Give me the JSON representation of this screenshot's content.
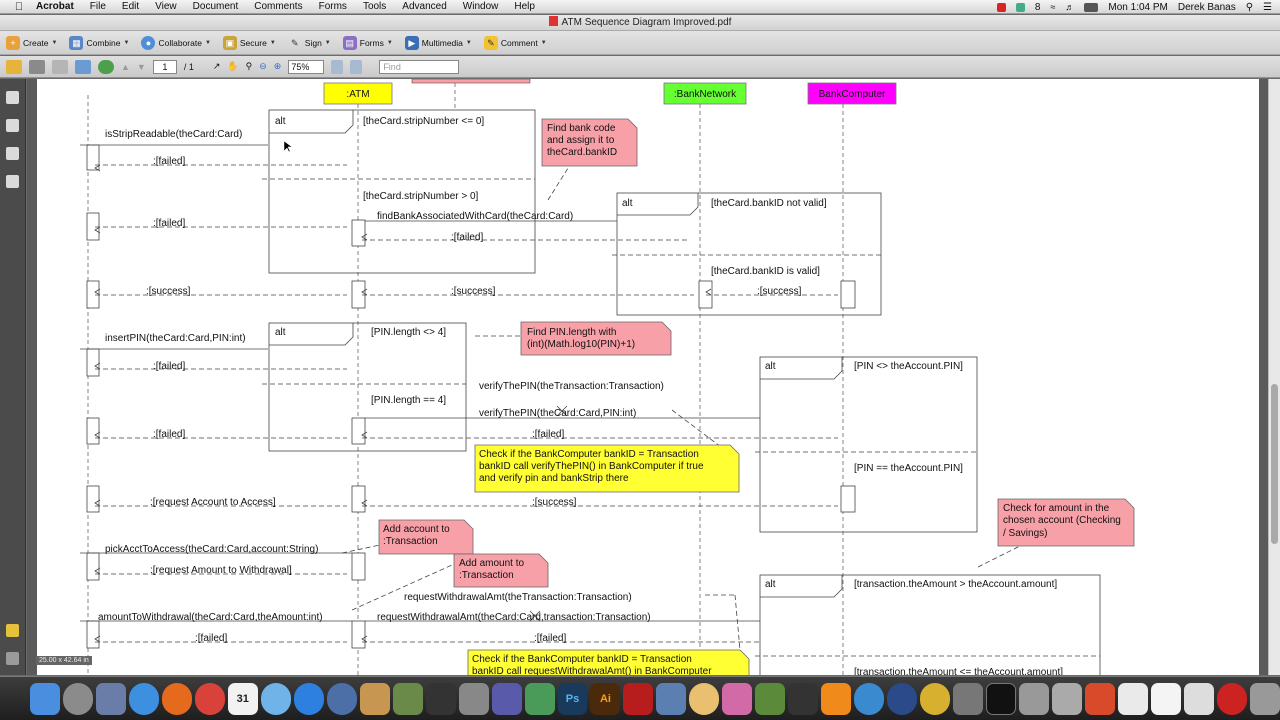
{
  "menubar": {
    "app": "Acrobat",
    "items": [
      "File",
      "Edit",
      "View",
      "Document",
      "Comments",
      "Forms",
      "Tools",
      "Advanced",
      "Window",
      "Help"
    ],
    "clock": "Mon 1:04 PM",
    "user": "Derek Banas",
    "badge_count": "8"
  },
  "window": {
    "title": "ATM Sequence Diagram Improved.pdf"
  },
  "toolbar1": {
    "create": "Create",
    "combine": "Combine",
    "collaborate": "Collaborate",
    "secure": "Secure",
    "sign": "Sign",
    "forms": "Forms",
    "multimedia": "Multimedia",
    "comment": "Comment"
  },
  "toolbar2": {
    "page_current": "1",
    "page_total": "/ 1",
    "zoom": "75%",
    "find_placeholder": "Find"
  },
  "status": {
    "page_size": "25.00 x 42.64 in"
  },
  "diagram": {
    "lifelines": {
      "atm": ":ATM",
      "network": ":BankNetwork",
      "computer": "BankComputer"
    },
    "messages": {
      "m1": "isStripReadable(theCard:Card)",
      "m2": ":[failed]",
      "m3": ":[failed]",
      "m4": "findBankAssociatedWithCard(theCard:Card)",
      "m5": ":[failed]",
      "m6": ":[success]",
      "m7": ":[success]",
      "m8": ":[success]",
      "m9": "insertPIN(theCard:Card,PIN:int)",
      "m10": ":[failed]",
      "m11": "verifyThePIN(theTransaction:Transaction)",
      "m12": "verifyThePIN(theCard:Card,PIN:int)",
      "m13": ":[failed]",
      "m14": ":[failed]",
      "m15": ":[request Account to Access]",
      "m16": ":[success]",
      "m17": "pickAcctToAccess(theCard:Card,account:String)",
      "m18": ":[request Amount to Withdrawal]",
      "m19": "requestWithdrawalAmt(theTransaction:Transaction)",
      "m20": "amountToWithdrawal(theCard:Card,theAmount:int)",
      "m21": "requestWithdrawalAmt(theCard:Card,transaction:Transaction)",
      "m22": ":[failed]",
      "m23": ":[failed]"
    },
    "frames": {
      "f1_label": "alt",
      "f1_guard1": "[theCard.stripNumber <= 0]",
      "f1_guard2": "[theCard.stripNumber > 0]",
      "f2_label": "alt",
      "f2_guard1": "[theCard.bankID not valid]",
      "f2_guard2": "[theCard.bankID is valid]",
      "f3_label": "alt",
      "f3_guard1": "[PIN.length <> 4]",
      "f3_guard2": "[PIN.length == 4]",
      "f4_label": "alt",
      "f4_guard1": "[PIN <> theAccount.PIN]",
      "f4_guard2": "[PIN == theAccount.PIN]",
      "f5_label": "alt",
      "f5_guard1": "[transaction.theAmount > theAccount.amount]",
      "f5_guard2": "[transaction.theAmount <= theAccount.amount]"
    },
    "notes": {
      "n1_l1": "Find bank code",
      "n1_l2": "and assign it to",
      "n1_l3": "theCard.bankID",
      "n2_l1": "Find PIN.length with",
      "n2_l2": "(int)(Math.log10(PIN)+1)",
      "n3_l1": "Check if the BankComputer bankID = Transaction",
      "n3_l2": "bankID call verifyThePIN() in BankComputer if true",
      "n3_l3": "and verify pin and bankStrip there",
      "n4_l1": "Add account to",
      "n4_l2": ":Transaction",
      "n5_l1": "Add amount to",
      "n5_l2": ":Transaction",
      "n6_l1": "Check for amount in the",
      "n6_l2": "chosen account (Checking",
      "n6_l3": "/ Savings)",
      "n7_l1": "Check if the BankComputer bankID = Transaction",
      "n7_l2": "bankID call requestWithdrawalAmt() in BankComputer"
    }
  },
  "colors": {
    "atm": "#ffff00",
    "network": "#66ff33",
    "computer": "#ff00ff",
    "note_pink": "#f8a0a8",
    "note_yellow": "#ffff33"
  },
  "dock": {
    "items": [
      "finder-icon",
      "launchpad-icon",
      "system-prefs-icon",
      "safari-icon",
      "firefox-icon",
      "chrome-icon",
      "calendar-icon",
      "itunes-icon",
      "app-store-icon",
      "quicktime-icon",
      "preview-icon",
      "starus-icon",
      "photo-icon",
      "pen-icon",
      "charts-icon",
      "photoshop-icon",
      "illustrator-icon",
      "acrobat-icon",
      "script-icon",
      "palette-icon",
      "android-icon",
      "minecraft-icon",
      "claquette-icon",
      "vlc-icon",
      "globe-icon",
      "skype-icon",
      "network-icon",
      "wrench-icon",
      "terminal-icon",
      "calculator-icon",
      "xcode-icon",
      "presentation-icon",
      "download-icon",
      "docs-icon",
      "mail-icon",
      "stop-icon",
      "trash-icon"
    ],
    "labels": {
      "ps": "Ps",
      "ai": "Ai",
      "calendar": "31"
    }
  }
}
